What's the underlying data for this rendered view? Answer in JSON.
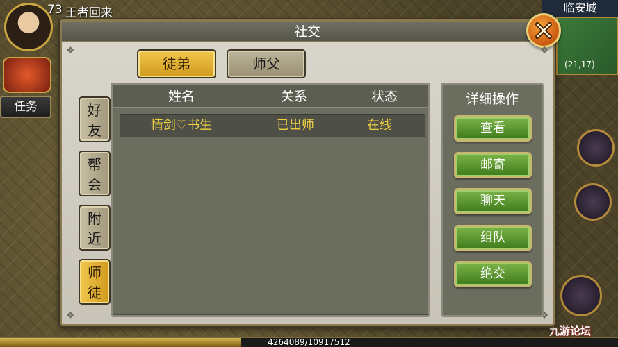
{
  "hud": {
    "level": "73",
    "player_name": "王者回来",
    "quest_button": "任务",
    "city_name": "临安城",
    "minimap_coords": "(21,17)",
    "exp_text": "4264089/10917512",
    "exp_progress": 0.39,
    "watermark": "九游论坛"
  },
  "dialog": {
    "title": "社交",
    "top_tabs": [
      {
        "label": "徒弟",
        "active": true
      },
      {
        "label": "师父",
        "active": false
      }
    ],
    "side_tabs": [
      {
        "chars": [
          "好",
          "友"
        ],
        "active": false
      },
      {
        "chars": [
          "帮",
          "会"
        ],
        "active": false
      },
      {
        "chars": [
          "附",
          "近"
        ],
        "active": false
      },
      {
        "chars": [
          "师",
          "徒"
        ],
        "active": true
      }
    ],
    "columns": [
      "姓名",
      "关系",
      "状态"
    ],
    "rows": [
      {
        "name": "情剑♡书生",
        "relation": "已出师",
        "status": "在线"
      }
    ],
    "actions": {
      "title": "详细操作",
      "buttons": [
        "查看",
        "邮寄",
        "聊天",
        "组队",
        "绝交"
      ]
    }
  },
  "colors": {
    "active_tab": "#f2c64d",
    "action_button": "#5a9a2e",
    "row_text": "#f0d040",
    "close_button": "#e8861f"
  },
  "icons": [
    "close-icon"
  ]
}
